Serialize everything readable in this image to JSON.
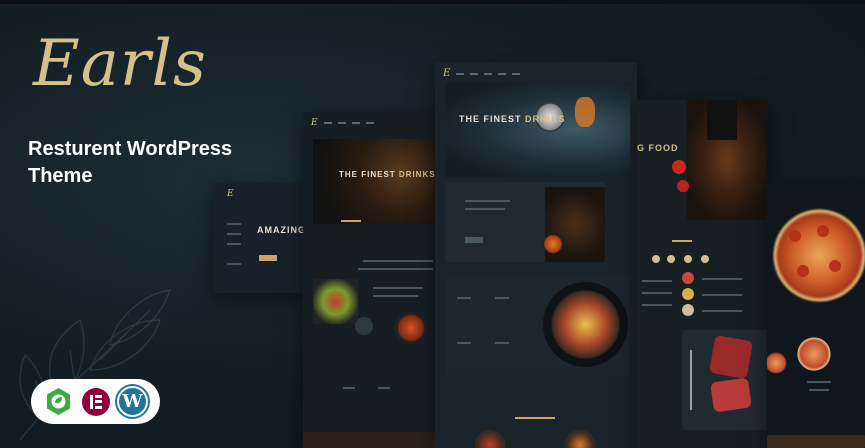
{
  "brand": {
    "logo_text": "Earls",
    "tagline": "Resturent WordPress Theme"
  },
  "badges": [
    "leaf-badge-icon",
    "elementor-icon",
    "wordpress-icon"
  ],
  "mockups": {
    "m2_hero": {
      "prefix": "THE FINEST ",
      "accent": "DRINKS"
    },
    "m3_hero": {
      "prefix": "THE FINEST ",
      "accent": "DRINKS"
    },
    "m1_hero": "AMAZING",
    "m4_hero": "G FOOD",
    "wp_letter": "W"
  },
  "colors": {
    "accent": "#d6c08a",
    "background": "#16222a",
    "badge_green": "#3dab3f",
    "elementor": "#92003b",
    "wordpress": "#21759b"
  }
}
